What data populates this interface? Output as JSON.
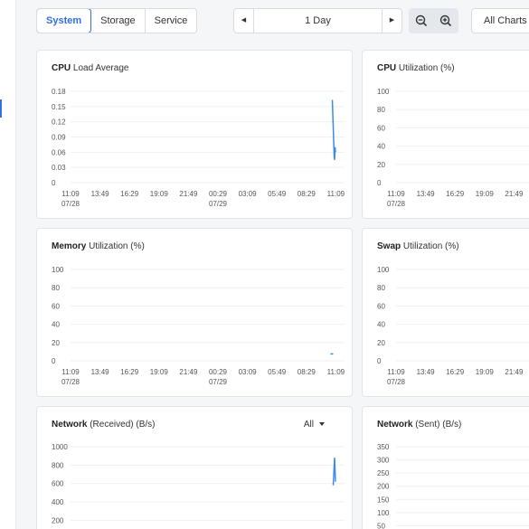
{
  "tabs": [
    "System",
    "Storage",
    "Service"
  ],
  "range": {
    "label": "1 Day",
    "prev": "◀",
    "next": "▶"
  },
  "all_charts_label": "All Charts",
  "charts": {
    "cpu_load": {
      "title_bold": "CPU",
      "title_rest": " Load Average",
      "yticks": [
        "0.18",
        "0.15",
        "0.12",
        "0.09",
        "0.06",
        "0.03",
        "0"
      ],
      "xticks": [
        "11:09",
        "13:49",
        "16:29",
        "19:09",
        "21:49",
        "00:29",
        "03:09",
        "05:49",
        "08:29",
        "11:09"
      ],
      "xdates": [
        "07/28",
        "",
        "",
        "",
        "",
        "07/29",
        "",
        "",
        "",
        ""
      ]
    },
    "cpu_util": {
      "title_bold": "CPU",
      "title_rest": " Utilization (%)",
      "yticks": [
        "100",
        "80",
        "60",
        "40",
        "20",
        "0"
      ],
      "xticks": [
        "11:09",
        "13:49",
        "16:29",
        "19:09",
        "21:49"
      ],
      "xdates": [
        "07/28",
        "",
        "",
        "",
        ""
      ]
    },
    "mem_util": {
      "title_bold": "Memory",
      "title_rest": " Utilization (%)",
      "yticks": [
        "100",
        "80",
        "60",
        "40",
        "20",
        "0"
      ],
      "xticks": [
        "11:09",
        "13:49",
        "16:29",
        "19:09",
        "21:49",
        "00:29",
        "03:09",
        "05:49",
        "08:29",
        "11:09"
      ],
      "xdates": [
        "07/28",
        "",
        "",
        "",
        "",
        "07/29",
        "",
        "",
        "",
        ""
      ]
    },
    "swap_util": {
      "title_bold": "Swap",
      "title_rest": " Utilization (%)",
      "yticks": [
        "100",
        "80",
        "60",
        "40",
        "20",
        "0"
      ],
      "xticks": [
        "11:09",
        "13:49",
        "16:29",
        "19:09",
        "21:49"
      ],
      "xdates": [
        "07/28",
        "",
        "",
        "",
        ""
      ]
    },
    "net_recv": {
      "title_bold": "Network",
      "title_rest": " (Received) (B/s)",
      "dropdown": "All",
      "yticks": [
        "1000",
        "800",
        "600",
        "400",
        "200"
      ]
    },
    "net_sent": {
      "title_bold": "Network",
      "title_rest": " (Sent) (B/s)",
      "yticks": [
        "350",
        "300",
        "250",
        "200",
        "150",
        "100",
        "50"
      ]
    }
  },
  "chart_data": [
    {
      "type": "line",
      "title": "CPU Load Average",
      "ylim": [
        0,
        0.18
      ],
      "x": [
        "10:50",
        "11:00",
        "11:02",
        "11:05",
        "11:07"
      ],
      "series": [
        {
          "values": [
            0.163,
            0.05,
            0.045,
            0.07,
            0.06
          ]
        }
      ]
    },
    {
      "type": "line",
      "title": "Memory Utilization (%)",
      "ylim": [
        0,
        100
      ],
      "x": [
        "10:40",
        "10:55"
      ],
      "series": [
        {
          "values": [
            7.5,
            7.5
          ]
        }
      ]
    },
    {
      "type": "line",
      "title": "Network (Received) (B/s)",
      "x": [
        "10:55",
        "11:02",
        "11:07"
      ],
      "series": [
        {
          "values": [
            580,
            880,
            620
          ]
        }
      ]
    }
  ],
  "colors": {
    "accent": "#2f6fde",
    "line": "#3b8beb"
  }
}
